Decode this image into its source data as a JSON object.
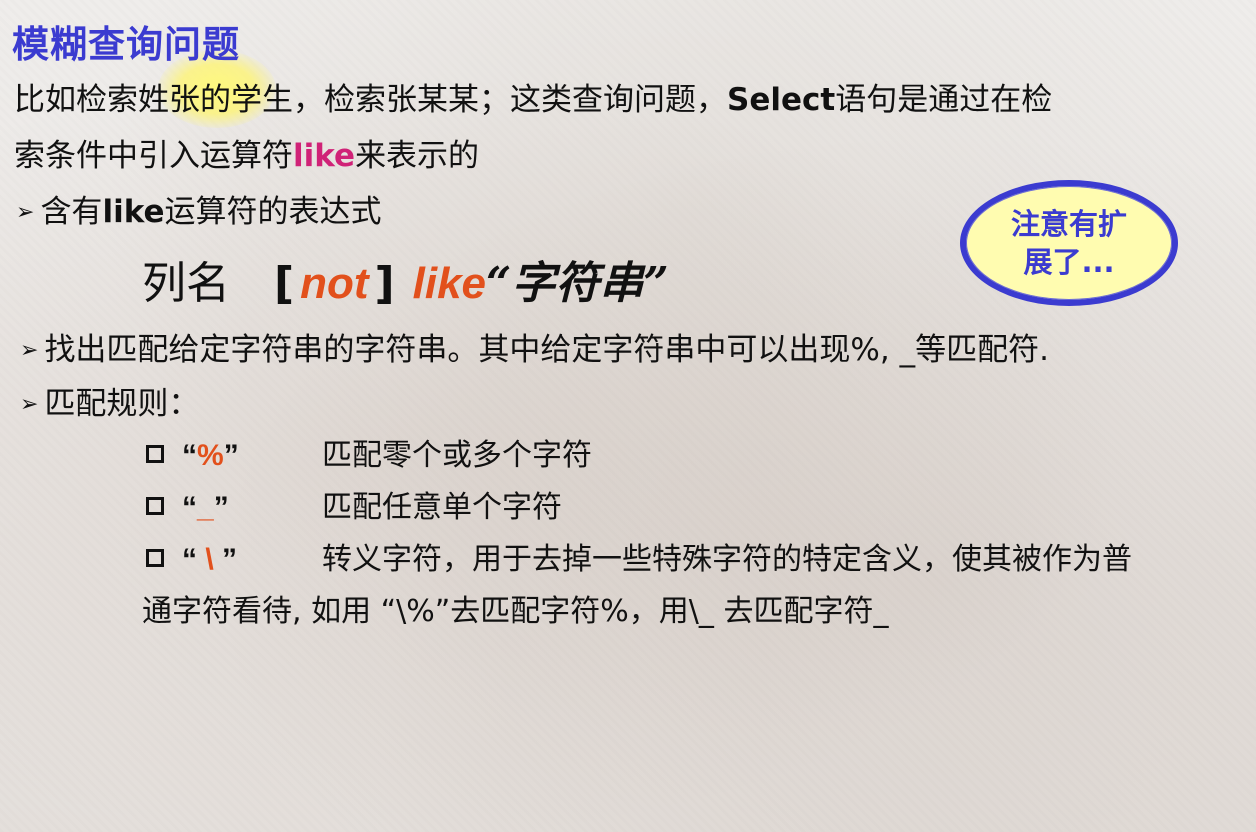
{
  "title": "模糊查询问题",
  "intro": {
    "part1": "比如检索姓张的学生，检索张某某；这类查询问题，",
    "select_word": "Select",
    "part2": "语句是通过在检",
    "line2_part1": "索条件中引入运算符",
    "like_word": "like",
    "line2_part2": "来表示的"
  },
  "bullet1": {
    "marker": "➢",
    "part1": "含有",
    "like_word": "like",
    "part2": "运算符的表达式"
  },
  "syntax": {
    "column_name": "列名",
    "open_bracket": "[",
    "not_kw": "not",
    "close_bracket": "]",
    "like_kw": "like",
    "string_literal": "“字符串”"
  },
  "callout": {
    "line1": "注意有扩",
    "line2": "展了..."
  },
  "bullet2": {
    "marker": "➢",
    "text": "找出匹配给定字符串的字符串。其中给定字符串中可以出现%, _等匹配符."
  },
  "bullet3": {
    "marker": "➢",
    "text": "匹配规则："
  },
  "rules": [
    {
      "quote_open": "“",
      "symbol": "%",
      "quote_close": "”",
      "description": "匹配零个或多个字符"
    },
    {
      "quote_open": "“",
      "symbol": "_",
      "quote_close": "”",
      "description": "匹配任意单个字符"
    },
    {
      "quote_open": "“",
      "symbol": " \\ ",
      "quote_close": "”",
      "description": "转义字符，用于去掉一些特殊字符的特定含义，使其被作为普"
    }
  ],
  "rule_continuation": "通字符看待, 如用 “\\%”去匹配字符%，用\\_ 去匹配字符_",
  "colors": {
    "title": "#3b3bd0",
    "accent_pink": "#d02277",
    "accent_orange": "#e2501c",
    "callout_fill": "#fffcb0",
    "highlight": "#fff578"
  }
}
